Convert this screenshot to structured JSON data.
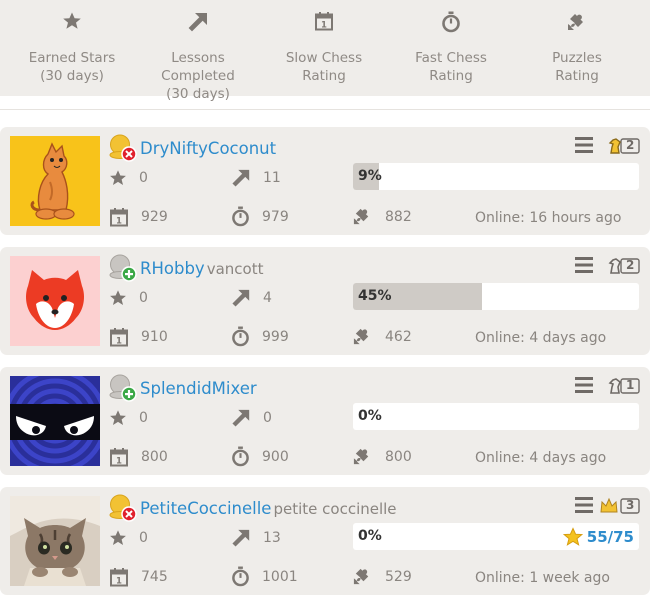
{
  "stats": [
    {
      "icon": "star-icon",
      "line1": "Earned Stars",
      "line2": "(30 days)"
    },
    {
      "icon": "arrow-up-right-icon",
      "line1": "Lessons Completed",
      "line2": "(30 days)"
    },
    {
      "icon": "calendar-icon",
      "line1": "Slow Chess",
      "line2": "Rating"
    },
    {
      "icon": "stopwatch-icon",
      "line1": "Fast Chess",
      "line2": "Rating"
    },
    {
      "icon": "puzzle-icon",
      "line1": "Puzzles",
      "line2": "Rating"
    }
  ],
  "members": [
    {
      "username": "DryNiftyCoconut",
      "real_name": "",
      "stars": "0",
      "lessons": "11",
      "slow": "929",
      "fast": "979",
      "puzzles": "882",
      "progress_label": "9%",
      "progress": 0.09,
      "online": "Online: 16 hours ago",
      "rank_level": "2",
      "avatar": "cat",
      "status": "offline-gold"
    },
    {
      "username": "RHobby",
      "real_name": "vancott",
      "stars": "0",
      "lessons": "4",
      "slow": "910",
      "fast": "999",
      "puzzles": "462",
      "progress_label": "45%",
      "progress": 0.45,
      "online": "Online: 4 days ago",
      "rank_level": "2",
      "avatar": "fox",
      "status": "online-gray"
    },
    {
      "username": "SplendidMixer",
      "real_name": "",
      "stars": "0",
      "lessons": "0",
      "slow": "800",
      "fast": "900",
      "puzzles": "800",
      "progress_label": "0%",
      "progress": 0,
      "online": "Online: 4 days ago",
      "rank_level": "1",
      "avatar": "ninja",
      "status": "online-gray"
    },
    {
      "username": "PetiteCoccinelle",
      "real_name": "petite coccinelle",
      "stars": "0",
      "lessons": "13",
      "slow": "745",
      "fast": "1001",
      "puzzles": "529",
      "progress_label": "0%",
      "progress": 0,
      "puzzles_done": "55/75",
      "online": "Online: 1 week ago",
      "rank_level": "3",
      "avatar": "kitten",
      "status": "offline-gold"
    }
  ],
  "colors": {
    "link": "#2e8ccc",
    "card_bg": "#efedea",
    "progress_fill": "#cfcbc6",
    "gold": "#f2c233"
  }
}
